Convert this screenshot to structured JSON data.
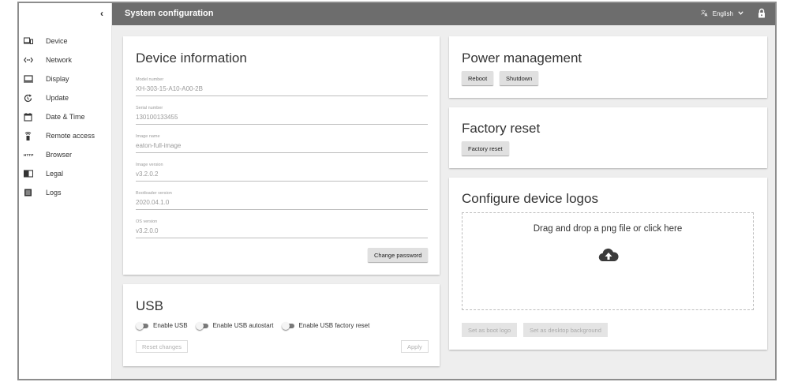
{
  "header": {
    "title": "System configuration",
    "language": "English",
    "language_icon": "translate-icon",
    "lock_icon": "lock-icon"
  },
  "sidebar": {
    "collapse_glyph": "‹",
    "items": [
      {
        "label": "Device",
        "icon": "device-icon"
      },
      {
        "label": "Network",
        "icon": "network-icon"
      },
      {
        "label": "Display",
        "icon": "display-icon"
      },
      {
        "label": "Update",
        "icon": "update-icon"
      },
      {
        "label": "Date & Time",
        "icon": "calendar-icon"
      },
      {
        "label": "Remote access",
        "icon": "remote-access-icon"
      },
      {
        "label": "Browser",
        "icon": "http-icon",
        "icon_text": "HTTP"
      },
      {
        "label": "Legal",
        "icon": "book-icon"
      },
      {
        "label": "Logs",
        "icon": "logs-icon"
      }
    ]
  },
  "device_info": {
    "title": "Device information",
    "fields": [
      {
        "label": "Model number",
        "value": "XH-303-15-A10-A00-2B"
      },
      {
        "label": "Serial number",
        "value": "130100133455"
      },
      {
        "label": "Image name",
        "value": "eaton-full-image"
      },
      {
        "label": "Image version",
        "value": "v3.2.0.2"
      },
      {
        "label": "Bootloader version",
        "value": "2020.04.1.0"
      },
      {
        "label": "OS version",
        "value": "v3.2.0.0"
      }
    ],
    "change_password_label": "Change password"
  },
  "usb": {
    "title": "USB",
    "toggles": [
      {
        "label": "Enable USB",
        "checked": false
      },
      {
        "label": "Enable USB autostart",
        "checked": false
      },
      {
        "label": "Enable USB factory reset",
        "checked": false
      }
    ],
    "reset_label": "Reset changes",
    "apply_label": "Apply"
  },
  "power": {
    "title": "Power management",
    "reboot_label": "Reboot",
    "shutdown_label": "Shutdown"
  },
  "factory": {
    "title": "Factory reset",
    "button_label": "Factory reset"
  },
  "logos": {
    "title": "Configure device logos",
    "dropzone_text": "Drag and drop a png file or click here",
    "upload_icon": "cloud-upload-icon",
    "boot_logo_label": "Set as boot logo",
    "desktop_bg_label": "Set as desktop background"
  },
  "colors": {
    "header_bg": "#6d6d6d",
    "page_bg": "#eeeeee",
    "button_bg": "#e0e0e0"
  }
}
